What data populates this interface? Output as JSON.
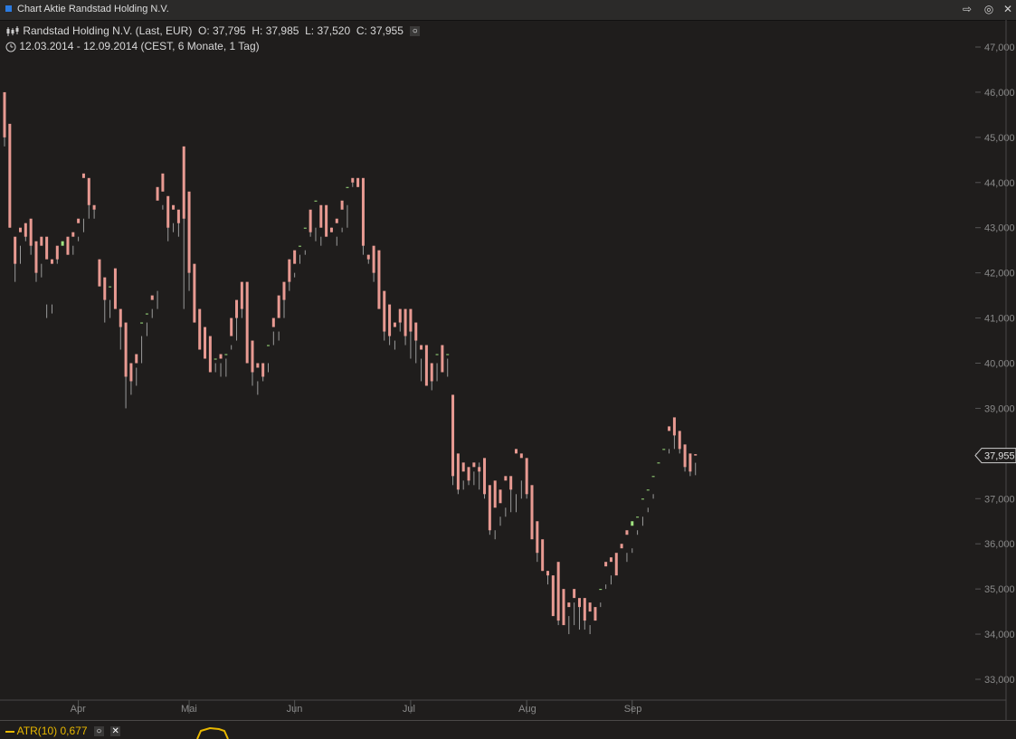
{
  "window": {
    "title": "Chart Aktie Randstad Holding N.V."
  },
  "header": {
    "instrument": "Randstad Holding N.V. (Last, EUR)",
    "open": "O: 37,795",
    "high": "H: 37,985",
    "low": "L: 37,520",
    "close": "C: 37,955",
    "range": "12.03.2014 - 12.09.2014 (CEST, 6 Monate, 1 Tag)"
  },
  "indicator": {
    "label": "ATR(10)",
    "value": "0,677"
  },
  "colors": {
    "up": "#9fe37f",
    "down": "#e89a92",
    "background": "#1f1d1c",
    "atr": "#e8b800",
    "axis_text": "#8a8a8a"
  },
  "chart_data": {
    "type": "candlestick",
    "title": "Randstad Holding N.V. (Last, EUR)",
    "y_ticks": [
      "47,000",
      "46,000",
      "45,000",
      "44,000",
      "43,000",
      "42,000",
      "41,000",
      "40,000",
      "39,000",
      "38,000",
      "37,000",
      "36,000",
      "35,000",
      "34,000",
      "33,000"
    ],
    "ylim": [
      33.0,
      47.0
    ],
    "x_ticks": [
      {
        "label": "Apr",
        "index": 14
      },
      {
        "label": "Mai",
        "index": 35
      },
      {
        "label": "Jun",
        "index": 55
      },
      {
        "label": "Jul",
        "index": 77
      },
      {
        "label": "Aug",
        "index": 99
      },
      {
        "label": "Sep",
        "index": 119
      }
    ],
    "last_price_label": "37,955",
    "last_price": 37.955,
    "candles": [
      [
        46.0,
        44.8,
        45.8,
        45.0
      ],
      [
        45.3,
        43.0,
        44.8,
        43.0
      ],
      [
        42.8,
        41.8,
        42.5,
        42.2
      ],
      [
        43.0,
        42.2,
        42.6,
        42.9
      ],
      [
        43.1,
        42.7,
        43.1,
        42.8
      ],
      [
        43.2,
        42.4,
        43.1,
        42.6
      ],
      [
        42.7,
        41.8,
        42.5,
        42.0
      ],
      [
        42.8,
        41.9,
        42.2,
        42.6
      ],
      [
        42.8,
        41.0,
        41.3,
        42.3
      ],
      [
        42.3,
        41.1,
        41.3,
        42.2
      ],
      [
        42.6,
        42.2,
        42.5,
        42.3
      ],
      [
        42.6,
        42.3,
        42.3,
        42.7
      ],
      [
        42.8,
        42.4,
        42.7,
        42.4
      ],
      [
        42.9,
        42.4,
        42.6,
        42.8
      ],
      [
        43.2,
        42.7,
        42.8,
        43.1
      ],
      [
        44.2,
        42.9,
        43.2,
        44.1
      ],
      [
        44.1,
        43.2,
        44.0,
        43.5
      ],
      [
        43.5,
        43.2,
        43.4,
        43.4
      ],
      [
        42.3,
        41.7,
        42.0,
        41.7
      ],
      [
        41.9,
        40.9,
        41.7,
        41.4
      ],
      [
        41.7,
        41.0,
        41.4,
        41.7
      ],
      [
        42.1,
        41.3,
        41.7,
        41.2
      ],
      [
        41.2,
        40.3,
        41.1,
        40.8
      ],
      [
        40.9,
        39.0,
        40.8,
        39.7
      ],
      [
        40.0,
        39.3,
        39.8,
        39.6
      ],
      [
        40.2,
        39.5,
        39.9,
        40.0
      ],
      [
        40.9,
        40.0,
        40.6,
        40.9
      ],
      [
        41.1,
        40.6,
        40.9,
        41.1
      ],
      [
        41.5,
        41.0,
        41.2,
        41.4
      ],
      [
        43.9,
        41.2,
        41.6,
        43.6
      ],
      [
        44.2,
        43.4,
        43.5,
        43.8
      ],
      [
        43.7,
        42.7,
        43.3,
        43.0
      ],
      [
        43.5,
        42.9,
        43.1,
        43.4
      ],
      [
        43.4,
        42.8,
        43.3,
        43.1
      ],
      [
        44.8,
        41.2,
        44.7,
        43.2
      ],
      [
        43.8,
        41.6,
        43.2,
        42.0
      ],
      [
        42.2,
        40.9,
        42.0,
        40.9
      ],
      [
        41.2,
        40.3,
        40.8,
        40.3
      ],
      [
        40.8,
        40.1,
        40.3,
        40.1
      ],
      [
        40.6,
        39.9,
        40.2,
        39.8
      ],
      [
        40.1,
        39.8,
        40.0,
        40.1
      ],
      [
        40.2,
        39.7,
        40.0,
        40.1
      ],
      [
        40.2,
        39.7,
        40.1,
        40.2
      ],
      [
        41.0,
        40.3,
        40.4,
        40.6
      ],
      [
        41.4,
        40.5,
        41.2,
        41.0
      ],
      [
        41.8,
        41.0,
        41.5,
        41.2
      ],
      [
        41.8,
        40.0,
        41.2,
        40.0
      ],
      [
        40.5,
        39.5,
        40.3,
        39.8
      ],
      [
        40.0,
        39.3,
        39.6,
        39.9
      ],
      [
        40.0,
        39.6,
        39.7,
        39.7
      ],
      [
        40.4,
        39.8,
        40.0,
        40.4
      ],
      [
        41.0,
        40.4,
        40.7,
        40.8
      ],
      [
        41.5,
        40.5,
        40.7,
        41.0
      ],
      [
        41.8,
        41.0,
        41.5,
        41.4
      ],
      [
        42.3,
        41.8,
        41.6,
        41.8
      ],
      [
        42.5,
        41.9,
        42.0,
        42.2
      ],
      [
        42.6,
        42.2,
        42.4,
        42.6
      ],
      [
        43.0,
        42.4,
        42.5,
        43.0
      ],
      [
        43.4,
        42.8,
        43.1,
        42.9
      ],
      [
        43.6,
        42.7,
        43.0,
        43.6
      ],
      [
        43.5,
        42.8,
        42.6,
        43.0
      ],
      [
        43.5,
        42.9,
        43.2,
        42.8
      ],
      [
        43.0,
        42.9,
        43.0,
        42.9
      ],
      [
        43.2,
        42.8,
        42.6,
        43.1
      ],
      [
        43.6,
        42.9,
        43.0,
        43.4
      ],
      [
        43.9,
        43.0,
        43.5,
        43.9
      ],
      [
        44.1,
        43.9,
        44.0,
        44.0
      ],
      [
        44.1,
        43.9,
        44.0,
        43.9
      ],
      [
        44.1,
        42.4,
        44.0,
        42.6
      ],
      [
        42.4,
        42.2,
        42.4,
        42.3
      ],
      [
        42.6,
        41.8,
        42.5,
        42.0
      ],
      [
        42.5,
        41.5,
        42.4,
        41.2
      ],
      [
        41.6,
        40.5,
        41.2,
        40.7
      ],
      [
        41.3,
        40.4,
        40.9,
        40.6
      ],
      [
        40.9,
        40.3,
        40.5,
        40.8
      ],
      [
        41.2,
        40.7,
        40.9,
        40.9
      ],
      [
        41.2,
        40.4,
        40.6,
        40.6
      ],
      [
        41.2,
        40.1,
        41.1,
        40.7
      ],
      [
        40.9,
        40.0,
        40.8,
        40.5
      ],
      [
        40.4,
        39.6,
        40.1,
        40.3
      ],
      [
        40.4,
        39.5,
        40.2,
        39.5
      ],
      [
        40.0,
        39.4,
        39.9,
        39.6
      ],
      [
        40.2,
        39.6,
        40.0,
        40.2
      ],
      [
        40.4,
        39.9,
        40.3,
        39.8
      ],
      [
        40.2,
        39.7,
        40.1,
        40.2
      ],
      [
        39.3,
        37.3,
        39.0,
        37.5
      ],
      [
        38.0,
        37.1,
        37.6,
        37.2
      ],
      [
        37.8,
        37.2,
        37.4,
        37.6
      ],
      [
        37.7,
        37.3,
        37.5,
        37.4
      ],
      [
        37.8,
        37.3,
        37.6,
        37.7
      ],
      [
        37.7,
        37.2,
        37.8,
        37.6
      ],
      [
        37.9,
        37.0,
        37.8,
        37.1
      ],
      [
        37.3,
        36.2,
        37.2,
        36.3
      ],
      [
        37.4,
        36.1,
        36.3,
        36.8
      ],
      [
        37.2,
        36.4,
        36.6,
        36.9
      ],
      [
        37.5,
        36.6,
        36.8,
        37.4
      ],
      [
        37.5,
        36.7,
        37.4,
        37.2
      ],
      [
        38.1,
        36.7,
        37.1,
        38.0
      ],
      [
        38.0,
        37.0,
        37.4,
        37.9
      ],
      [
        37.9,
        37.0,
        37.8,
        37.1
      ],
      [
        37.3,
        36.2,
        37.2,
        36.1
      ],
      [
        36.5,
        35.6,
        36.3,
        35.8
      ],
      [
        36.1,
        35.4,
        35.8,
        35.4
      ],
      [
        35.4,
        35.1,
        35.4,
        35.3
      ],
      [
        35.3,
        34.5,
        35.3,
        34.4
      ],
      [
        35.6,
        34.2,
        34.8,
        34.3
      ],
      [
        35.0,
        34.3,
        34.6,
        34.2
      ],
      [
        34.7,
        34.0,
        34.4,
        34.6
      ],
      [
        35.0,
        34.2,
        34.7,
        34.8
      ],
      [
        34.8,
        34.1,
        34.7,
        34.6
      ],
      [
        34.8,
        34.1,
        34.5,
        34.3
      ],
      [
        34.7,
        34.0,
        34.2,
        34.5
      ],
      [
        34.6,
        34.3,
        34.4,
        34.3
      ],
      [
        35.0,
        34.6,
        34.7,
        35.0
      ],
      [
        35.6,
        35.0,
        35.1,
        35.5
      ],
      [
        35.7,
        35.1,
        35.3,
        35.6
      ],
      [
        35.8,
        35.5,
        35.6,
        35.3
      ],
      [
        36.0,
        35.5,
        35.5,
        35.9
      ],
      [
        36.3,
        35.6,
        35.8,
        36.2
      ],
      [
        36.4,
        35.8,
        35.9,
        36.5
      ],
      [
        36.6,
        36.2,
        36.3,
        36.6
      ],
      [
        37.0,
        36.4,
        36.6,
        37.0
      ],
      [
        37.2,
        36.7,
        36.8,
        37.2
      ],
      [
        37.5,
        37.0,
        37.1,
        37.5
      ],
      [
        37.8,
        37.4,
        37.4,
        37.8
      ],
      [
        38.1,
        37.6,
        37.6,
        38.1
      ],
      [
        38.6,
        38.1,
        38.0,
        38.5
      ],
      [
        38.8,
        38.1,
        38.5,
        38.4
      ],
      [
        38.5,
        38.0,
        38.4,
        38.1
      ],
      [
        38.2,
        37.6,
        38.0,
        37.7
      ],
      [
        38.0,
        37.5,
        37.9,
        37.6
      ],
      [
        37.985,
        37.52,
        37.795,
        37.955
      ]
    ]
  }
}
